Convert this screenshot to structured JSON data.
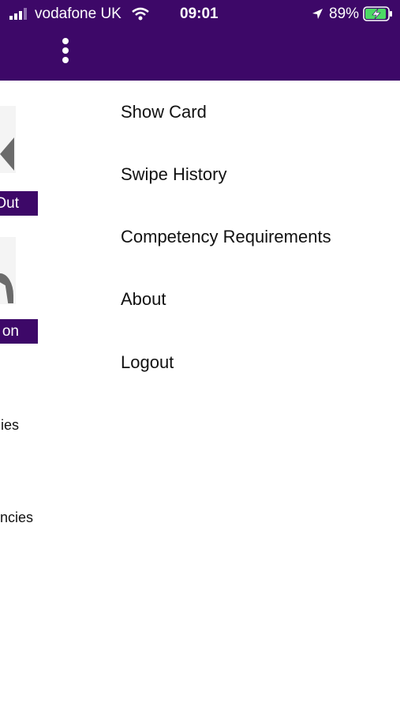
{
  "status_bar": {
    "carrier": "vodafone UK",
    "time": "09:01",
    "battery_percent": "89%",
    "icons": [
      "signal-icon",
      "wifi-icon",
      "location-arrow-icon",
      "battery-charging-icon"
    ]
  },
  "app_bar": {
    "background_color": "#3d0868",
    "menu_icon": "kebab-menu-icon"
  },
  "background_screen": {
    "buttons": [
      {
        "label": "Out"
      },
      {
        "label": "on"
      }
    ],
    "texts": [
      {
        "label": "ies"
      },
      {
        "label": "ncies"
      }
    ]
  },
  "menu": {
    "items": [
      {
        "label": "Show Card"
      },
      {
        "label": "Swipe History"
      },
      {
        "label": "Competency Requirements"
      },
      {
        "label": "About"
      },
      {
        "label": "Logout"
      }
    ]
  }
}
